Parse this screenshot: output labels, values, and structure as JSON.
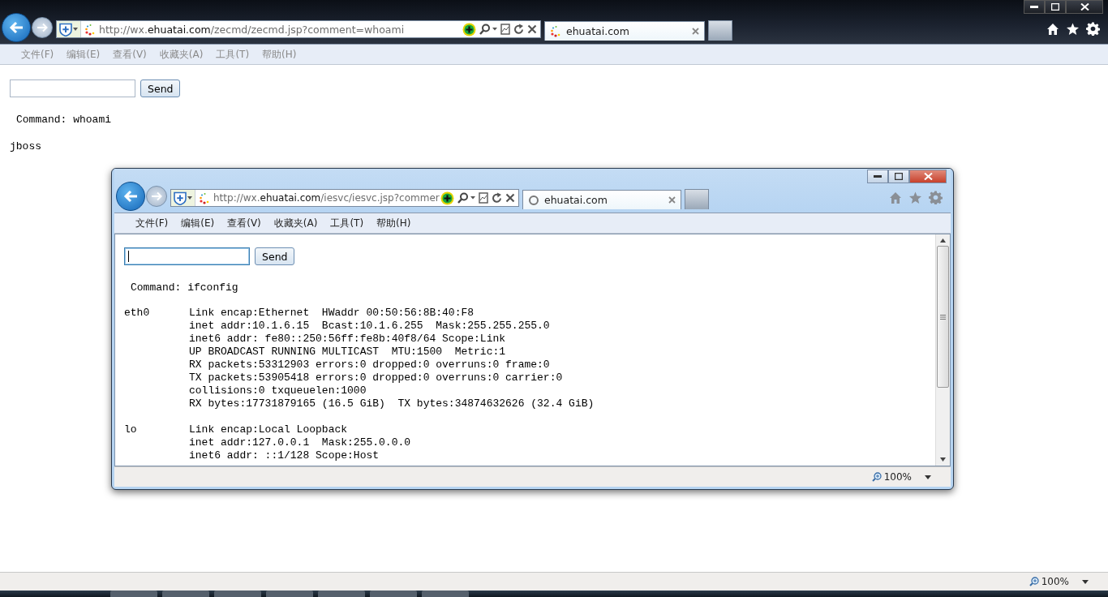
{
  "outer": {
    "active": false,
    "address": "http://wx.**ehuatai.com**/zecmd/zecmd.jsp?comment=whoami",
    "tabs": [
      {
        "title": "ehuatai.com",
        "selected": true,
        "kind": "loaded"
      }
    ],
    "menu": [
      "文件(F)",
      "编辑(E)",
      "查看(V)",
      "收藏夹(A)",
      "工具(T)",
      "帮助(H)"
    ],
    "page": {
      "focused": false,
      "send_button": "Send",
      "command": "Command: whoami",
      "result": "jboss"
    },
    "status": {
      "zoom": "100%"
    }
  },
  "inner": {
    "active": true,
    "address": "http://wx.**ehuatai.com**/iesvc/iesvc.jsp?commer",
    "tabs": [
      {
        "title": "ehuatai.com",
        "selected": true,
        "kind": "loading"
      }
    ],
    "menu": [
      "文件(F)",
      "编辑(E)",
      "查看(V)",
      "收藏夹(A)",
      "工具(T)",
      "帮助(H)"
    ],
    "page": {
      "focused": true,
      "send_button": "Send",
      "command": "Command: ifconfig",
      "interfaces": [
        {
          "name": "eth0",
          "lines": [
            "Link encap:Ethernet  HWaddr 00:50:56:8B:40:F8",
            "inet addr:10.1.6.15  Bcast:10.1.6.255  Mask:255.255.255.0",
            "inet6 addr: fe80::250:56ff:fe8b:40f8/64 Scope:Link",
            "UP BROADCAST RUNNING MULTICAST  MTU:1500  Metric:1",
            "RX packets:53312903 errors:0 dropped:0 overruns:0 frame:0",
            "TX packets:53905418 errors:0 dropped:0 overruns:0 carrier:0",
            "collisions:0 txqueuelen:1000",
            "RX bytes:17731879165 (16.5 GiB)  TX bytes:34874632626 (32.4 GiB)"
          ]
        },
        {
          "name": "lo",
          "lines": [
            "Link encap:Local Loopback",
            "inet addr:127.0.0.1  Mask:255.0.0.0",
            "inet6 addr: ::1/128 Scope:Host"
          ]
        }
      ]
    },
    "status": {
      "zoom": "100%"
    }
  }
}
